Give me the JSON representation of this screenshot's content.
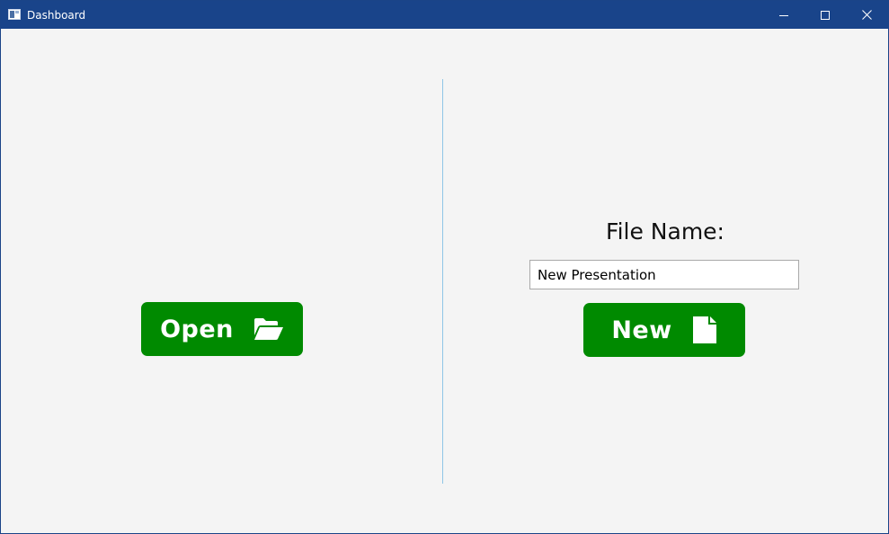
{
  "window": {
    "title": "Dashboard",
    "controls": {
      "minimize": "minimize-icon",
      "maximize": "maximize-icon",
      "close": "close-icon"
    }
  },
  "open_panel": {
    "button_label": "Open",
    "button_icon": "folder-open-icon"
  },
  "new_panel": {
    "file_name_label": "File Name:",
    "file_name_value": "New Presentation",
    "button_label": "New",
    "button_icon": "file-icon"
  },
  "colors": {
    "titlebar": "#19448a",
    "button": "#008a00",
    "divider": "#8fc6e6",
    "background": "#f4f4f4"
  }
}
